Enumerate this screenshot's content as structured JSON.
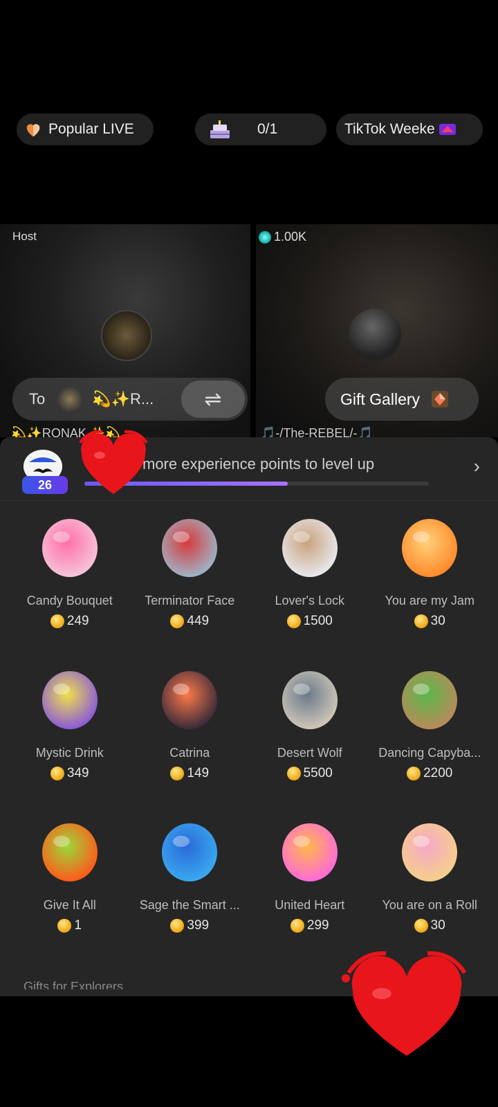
{
  "top_bar": {
    "popular_label": "Popular LIVE",
    "progress_label": "0/1",
    "weekend_label": "TikTok Weeke"
  },
  "host_tile": {
    "label": "Host",
    "to_prefix": "To",
    "to_name": "💫✨R...",
    "swap_symbol": "⇌",
    "name_strip": "💫✨RONAK ✨💫"
  },
  "guest_tile": {
    "coins": "1.00K",
    "gift_gallery_label": "Gift Gallery",
    "name_strip": "🎵-/The-REBEL/-🎵"
  },
  "level": {
    "badge": "26",
    "text": "more experience points to level up",
    "progress": 0.59,
    "chevron": "›"
  },
  "gifts": [
    {
      "name": "Candy Bouquet",
      "price": "249",
      "icon": "candy-bouquet-icon"
    },
    {
      "name": "Terminator Face",
      "price": "449",
      "icon": "terminator-face-icon"
    },
    {
      "name": "Lover's Lock",
      "price": "1500",
      "icon": "lovers-lock-icon"
    },
    {
      "name": "You are my Jam",
      "price": "30",
      "icon": "jam-jar-icon"
    },
    {
      "name": "Mystic Drink",
      "price": "349",
      "icon": "mystic-drink-icon"
    },
    {
      "name": "Catrina",
      "price": "149",
      "icon": "catrina-icon"
    },
    {
      "name": "Desert Wolf",
      "price": "5500",
      "icon": "desert-wolf-icon"
    },
    {
      "name": "Dancing Capyba...",
      "price": "2200",
      "icon": "capybara-icon"
    },
    {
      "name": "Give It All",
      "price": "1",
      "icon": "flaming-wheel-icon"
    },
    {
      "name": "Sage the Smart ...",
      "price": "399",
      "icon": "sage-icon"
    },
    {
      "name": "United Heart",
      "price": "299",
      "icon": "united-heart-icon"
    },
    {
      "name": "You are on a Roll",
      "price": "30",
      "icon": "cake-roll-icon"
    }
  ],
  "bottom": {
    "partial_text": "Gifts for Explorers"
  },
  "colors": {
    "sheet_bg": "#262626",
    "accent": "#8b63f5",
    "coin": "#f2b021",
    "heart": "#e8151b"
  }
}
